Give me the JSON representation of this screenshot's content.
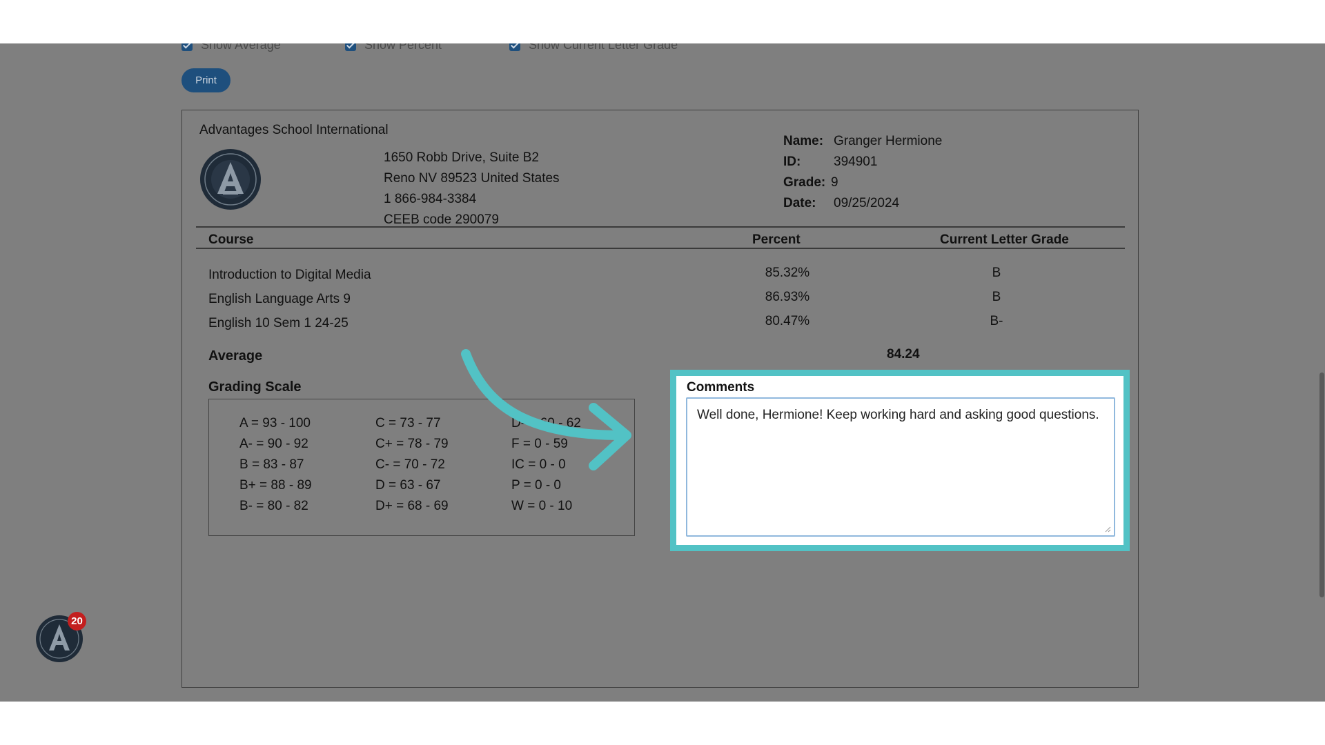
{
  "options": {
    "show_average": "Show Average",
    "show_percent": "Show Percent",
    "show_letter_grade": "Show Current Letter Grade"
  },
  "print_label": "Print",
  "school": {
    "name": "Advantages School International",
    "address_line1": "1650 Robb Drive, Suite B2",
    "address_line2": "Reno NV 89523 United States",
    "phone": "1 866-984-3384",
    "ceeb": "CEEB code 290079"
  },
  "student": {
    "name_label": "Name:",
    "name": "Granger Hermione",
    "id_label": "ID:",
    "id": "394901",
    "grade_label": "Grade:",
    "grade": "9",
    "date_label": "Date:",
    "date": "09/25/2024"
  },
  "table": {
    "headers": [
      "Course",
      "Percent",
      "Current Letter Grade"
    ],
    "rows": [
      {
        "course": "Introduction to Digital Media",
        "percent": "85.32%",
        "letter": "B"
      },
      {
        "course": "English Language Arts 9",
        "percent": "86.93%",
        "letter": "B"
      },
      {
        "course": "English 10 Sem 1 24-25",
        "percent": "80.47%",
        "letter": "B-"
      }
    ],
    "average_label": "Average",
    "average_value": "84.24"
  },
  "grading_scale": {
    "title": "Grading Scale",
    "col1": [
      "A = 93 - 100",
      "A- = 90 - 92",
      "B = 83 - 87",
      "B+ = 88 - 89",
      "B- = 80 - 82"
    ],
    "col2": [
      "C = 73 - 77",
      "C+ = 78 - 79",
      "C- = 70 - 72",
      "D = 63 - 67",
      "D+ = 68 - 69"
    ],
    "col3": [
      "D- = 60 - 62",
      "F = 0 - 59",
      "IC = 0 - 0",
      "P = 0 - 0",
      "W = 0 - 10"
    ]
  },
  "comments": {
    "label": "Comments",
    "value": "Well done, Hermione! Keep working hard and asking good questions."
  },
  "notification_count": "20",
  "colors": {
    "highlight": "#52c2c5",
    "accent": "#1e4f7d",
    "badge": "#c31f1f"
  }
}
